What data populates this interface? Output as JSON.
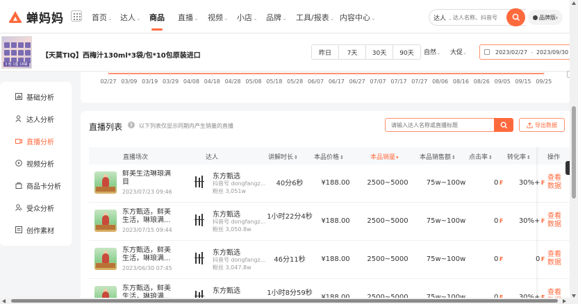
{
  "brand": {
    "logo_text": "蝉妈妈",
    "accent": "#ff6a3d"
  },
  "nav": {
    "items": [
      {
        "label": "首页",
        "caret": "⌄"
      },
      {
        "label": "达人",
        "caret": "⌄"
      },
      {
        "label": "商品",
        "caret": ""
      },
      {
        "label": "直播",
        "caret": "⌄"
      },
      {
        "label": "视频",
        "caret": "⌄"
      },
      {
        "label": "小店",
        "caret": "⌄"
      },
      {
        "label": "品牌",
        "caret": "⌄"
      },
      {
        "label": "工具/报表",
        "caret": "⌄"
      },
      {
        "label": "内容中心",
        "caret": "⌄"
      }
    ],
    "active_index": 2
  },
  "search": {
    "type_label": "达人",
    "placeholder": "达人名称、抖音号",
    "search_icon": "search-icon"
  },
  "brand_pill": {
    "label": "品牌版",
    "caret": "›"
  },
  "product": {
    "title": "【天莫TIQ】西梅汁130ml*3袋/包*10包原装进口",
    "thumb_label": "3 包 1盒 18袋"
  },
  "periods": [
    "昨日",
    "7天",
    "30天",
    "90天"
  ],
  "mode": {
    "label": "自然",
    "caret": "⌄"
  },
  "day_select": {
    "label": "大促",
    "caret": "⌄"
  },
  "date_range": {
    "start": "2023/02/27",
    "sep": "-",
    "end": "2023/09/30"
  },
  "chart_data": {
    "type": "line",
    "x": [
      "02/27",
      "03/09",
      "03/19",
      "03/29",
      "04/08",
      "04/18",
      "04/28",
      "05/08",
      "05/18",
      "05/28",
      "06/07",
      "06/17",
      "06/27",
      "07/07",
      "07/17",
      "07/27",
      "08/06",
      "08/16",
      "08/26",
      "09/05",
      "09/15",
      "09/25"
    ],
    "series_color": "#ff6a3d"
  },
  "sidebar": {
    "items": [
      {
        "label": "基础分析",
        "icon": "bar-chart-icon"
      },
      {
        "label": "达人分析",
        "icon": "person-icon"
      },
      {
        "label": "直播分析",
        "icon": "live-icon"
      },
      {
        "label": "视频分析",
        "icon": "play-icon"
      },
      {
        "label": "商品卡分析",
        "icon": "bag-icon"
      },
      {
        "label": "受众分析",
        "icon": "audience-icon"
      },
      {
        "label": "创作素材",
        "icon": "folder-icon"
      }
    ],
    "active_index": 2
  },
  "table": {
    "title": "直播列表",
    "hint": "以下列表仅显示同期内产生销量的直播",
    "search_placeholder": "请输入达人名称或直播标题",
    "export_label": "导出数据",
    "columns": [
      "直播场次",
      "达人",
      "讲解时长",
      "本品价格",
      "本品销量",
      "本品销售额",
      "点击率",
      "转化率",
      "操作"
    ],
    "sorted_column": "本品销量",
    "rows": [
      {
        "live_name": "鲜美生活琳琅满目",
        "live_time": "2023/07/23 09:46",
        "talent_name": "东方甄选",
        "talent_id": "抖音号 dongfangz...",
        "talent_fans": "粉丝 3,051w",
        "duration": "40分6秒",
        "price": "¥188.00",
        "sales": "2500~5000",
        "amount": "75w~100w",
        "click": "0",
        "conv": "30%+",
        "op": "查看数据"
      },
      {
        "live_name": "东方甄选，鲜美生活，琳琅满...",
        "live_time": "2023/07/15 09:44",
        "talent_name": "东方甄选",
        "talent_id": "抖音号 dongfangz...",
        "talent_fans": "粉丝 3,050.8w",
        "duration": "1小时22分4秒",
        "price": "¥188.00",
        "sales": "2500~5000",
        "amount": "75w~100w",
        "click": "0",
        "conv": "30%+",
        "op": "查看数据"
      },
      {
        "live_name": "东方甄选，鲜美生活，琳琅满...",
        "live_time": "2023/06/30 07:45",
        "talent_name": "东方甄选",
        "talent_id": "抖音号 dongfangz...",
        "talent_fans": "粉丝 3,047.8w",
        "duration": "46分11秒",
        "price": "¥188.00",
        "sales": "2500~5000",
        "amount": "75w~100w",
        "click": "0",
        "conv": "0",
        "op": "查看数据"
      },
      {
        "live_name": "东方甄选，鲜美生活，琳琅满...",
        "live_time": "",
        "talent_name": "东方甄选",
        "talent_id": "",
        "talent_fans": "",
        "duration": "1小时8分59秒",
        "price": "¥188.00",
        "sales": "2500~5000",
        "amount": "75w~100w",
        "click": "0",
        "conv": "30%+",
        "op": "查看数据"
      }
    ]
  }
}
